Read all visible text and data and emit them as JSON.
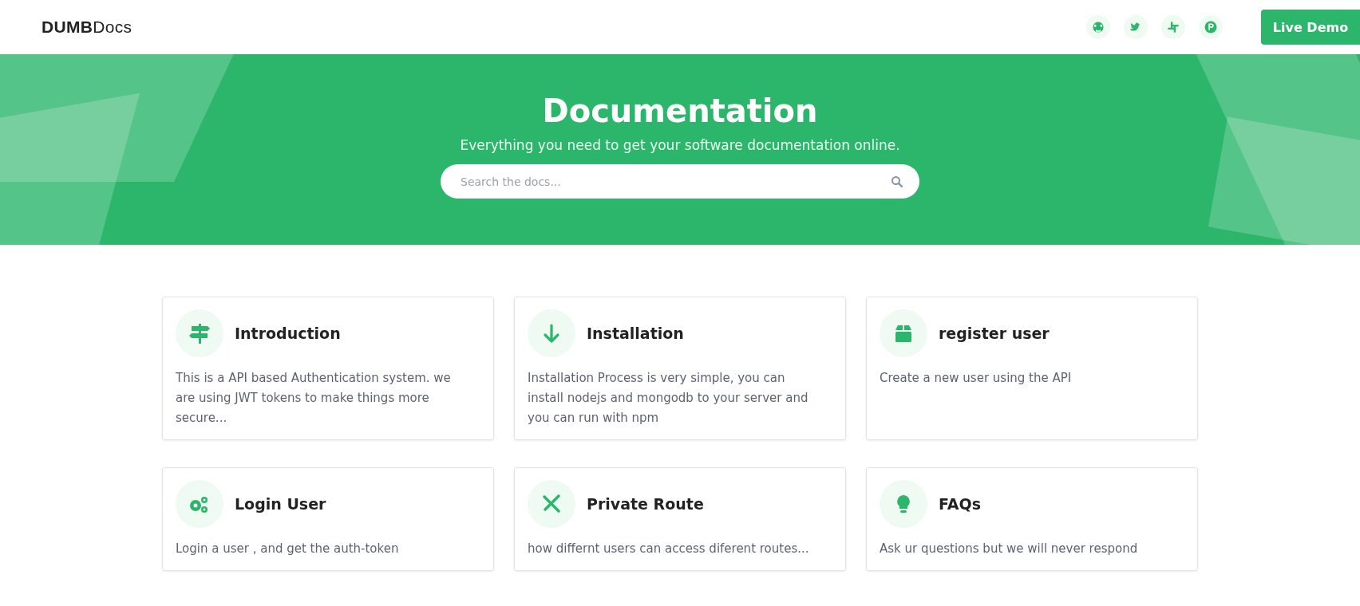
{
  "header": {
    "logo_bold": "DUMB",
    "logo_light": "Docs",
    "button": "Live Demo"
  },
  "hero": {
    "title": "Documentation",
    "subtitle": "Everything you need to get your software documentation online.",
    "search": {
      "placeholder": "Search the docs..."
    }
  },
  "cards": [
    {
      "title": "Introduction",
      "text": "This is a API based Authentication system. we are using JWT tokens to make things more secure..."
    },
    {
      "title": "Installation",
      "text": "Installation Process is very simple, you can install nodejs and mongodb to your server and you can run with npm"
    },
    {
      "title": "register user",
      "text": "Create a new user using the API"
    },
    {
      "title": "Login User",
      "text": "Login a user , and get the auth-token"
    },
    {
      "title": "Private Route",
      "text": "how differnt users can access diferent routes..."
    },
    {
      "title": "FAQs",
      "text": "Ask ur questions but we will never respond"
    }
  ]
}
